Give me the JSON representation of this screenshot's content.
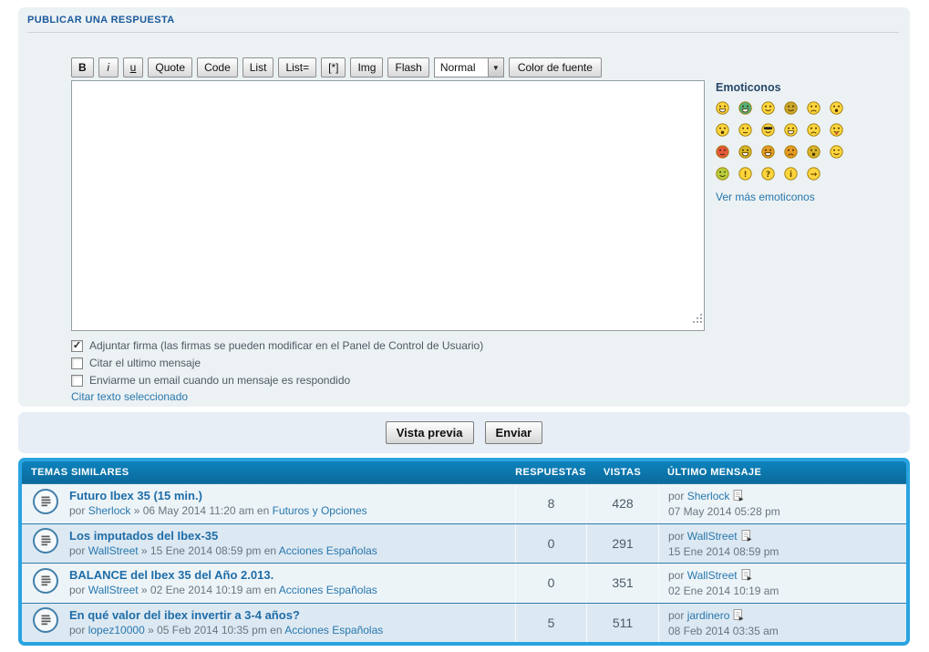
{
  "post_form": {
    "title": "PUBLICAR UNA RESPUESTA",
    "toolbar": {
      "buttons": [
        {
          "name": "bold",
          "label": "B",
          "style": "bold"
        },
        {
          "name": "italic",
          "label": "i",
          "style": "italic"
        },
        {
          "name": "underline",
          "label": "u",
          "style": "underline"
        },
        {
          "name": "quote",
          "label": "Quote"
        },
        {
          "name": "code",
          "label": "Code"
        },
        {
          "name": "list",
          "label": "List"
        },
        {
          "name": "list-ordered",
          "label": "List="
        },
        {
          "name": "list-item",
          "label": "[*]"
        },
        {
          "name": "img",
          "label": "Img"
        },
        {
          "name": "flash",
          "label": "Flash"
        }
      ],
      "font_select_value": "Normal",
      "font_color_label": "Color de fuente"
    },
    "message_value": "",
    "options": [
      {
        "name": "attach-signature",
        "label": "Adjuntar firma (las firmas se pueden modificar en el Panel de Control de Usuario)",
        "checked": true
      },
      {
        "name": "quote-last-message",
        "label": "Citar el ultimo mensaje",
        "checked": false
      },
      {
        "name": "email-on-reply",
        "label": "Enviarme un email cuando un mensaje es respondido",
        "checked": false
      }
    ],
    "quote_selected_label": "Citar texto seleccionado"
  },
  "smilies": {
    "title": "Emoticonos",
    "more_label": "Ver más emoticonos",
    "items": [
      {
        "name": "biggrin",
        "color": "#ffd53e",
        "mouth": "grin"
      },
      {
        "name": "mrgreen",
        "color": "#53b07c",
        "mouth": "grin"
      },
      {
        "name": "smile",
        "color": "#ffd53e",
        "mouth": "smile"
      },
      {
        "name": "smile-dark",
        "color": "#c9a62c",
        "mouth": "smile"
      },
      {
        "name": "sad",
        "color": "#ffd53e",
        "mouth": "sad"
      },
      {
        "name": "surprised",
        "color": "#ffd53e",
        "mouth": "o"
      },
      {
        "name": "eek",
        "color": "#ffd53e",
        "mouth": "o"
      },
      {
        "name": "neutral",
        "color": "#ffd53e",
        "mouth": "flat"
      },
      {
        "name": "cool",
        "color": "#ffd53e",
        "mouth": "shades"
      },
      {
        "name": "lol",
        "color": "#ffd53e",
        "mouth": "grin"
      },
      {
        "name": "mad",
        "color": "#ffd53e",
        "mouth": "sad"
      },
      {
        "name": "razz",
        "color": "#ffd53e",
        "mouth": "tongue"
      },
      {
        "name": "redface",
        "color": "#e4573d",
        "mouth": "flat"
      },
      {
        "name": "geek",
        "color": "#d8b62a",
        "mouth": "grin"
      },
      {
        "name": "evil",
        "color": "#e59b23",
        "mouth": "grin"
      },
      {
        "name": "twisted",
        "color": "#e59b23",
        "mouth": "sad"
      },
      {
        "name": "dizzy",
        "color": "#d8b62a",
        "mouth": "o"
      },
      {
        "name": "wink",
        "color": "#ffd53e",
        "mouth": "wink"
      },
      {
        "name": "wink-green",
        "color": "#b8cf3e",
        "mouth": "wink"
      },
      {
        "name": "exclaim",
        "color": "#ffd53e",
        "symbol": "!"
      },
      {
        "name": "question",
        "color": "#ffd53e",
        "symbol": "?"
      },
      {
        "name": "idea",
        "color": "#ffd53e",
        "symbol": "i"
      },
      {
        "name": "arrow",
        "color": "#ffd53e",
        "symbol": "→"
      }
    ]
  },
  "actions": {
    "preview_label": "Vista previa",
    "submit_label": "Enviar"
  },
  "similar_topics": {
    "title": "TEMAS SIMILARES",
    "columns": {
      "replies": "RESPUESTAS",
      "views": "VISTAS",
      "last_message": "ÚLTIMO MENSAJE"
    },
    "labels": {
      "by": "por",
      "sep": "»",
      "in": "en"
    },
    "rows": [
      {
        "title": "Futuro Ibex 35 (15 min.)",
        "author": "Sherlock",
        "posted": "06 May 2014 11:20 am",
        "forum": "Futuros y Opciones",
        "replies": "8",
        "views": "428",
        "last_author": "Sherlock",
        "last_date": "07 May 2014 05:28 pm"
      },
      {
        "title": "Los imputados del Ibex-35",
        "author": "WallStreet",
        "posted": "15 Ene 2014 08:59 pm",
        "forum": "Acciones Españolas",
        "replies": "0",
        "views": "291",
        "last_author": "WallStreet",
        "last_date": "15 Ene 2014 08:59 pm"
      },
      {
        "title": "BALANCE del Ibex 35 del Año 2.013.",
        "author": "WallStreet",
        "posted": "02 Ene 2014 10:19 am",
        "forum": "Acciones Españolas",
        "replies": "0",
        "views": "351",
        "last_author": "WallStreet",
        "last_date": "02 Ene 2014 10:19 am"
      },
      {
        "title": "En qué valor del ibex invertir a 3-4 años?",
        "author": "lopez10000",
        "posted": "05 Feb 2014 10:35 pm",
        "forum": "Acciones Españolas",
        "replies": "5",
        "views": "511",
        "last_author": "jardinero",
        "last_date": "08 Feb 2014 03:35 am"
      }
    ]
  },
  "colors": {
    "accent_border": "#29a3e0",
    "header_bar": "#0d7ab1",
    "link": "#2777ad",
    "panel_bg": "#ecf1f3",
    "title_blue": "#1a5a9e"
  }
}
